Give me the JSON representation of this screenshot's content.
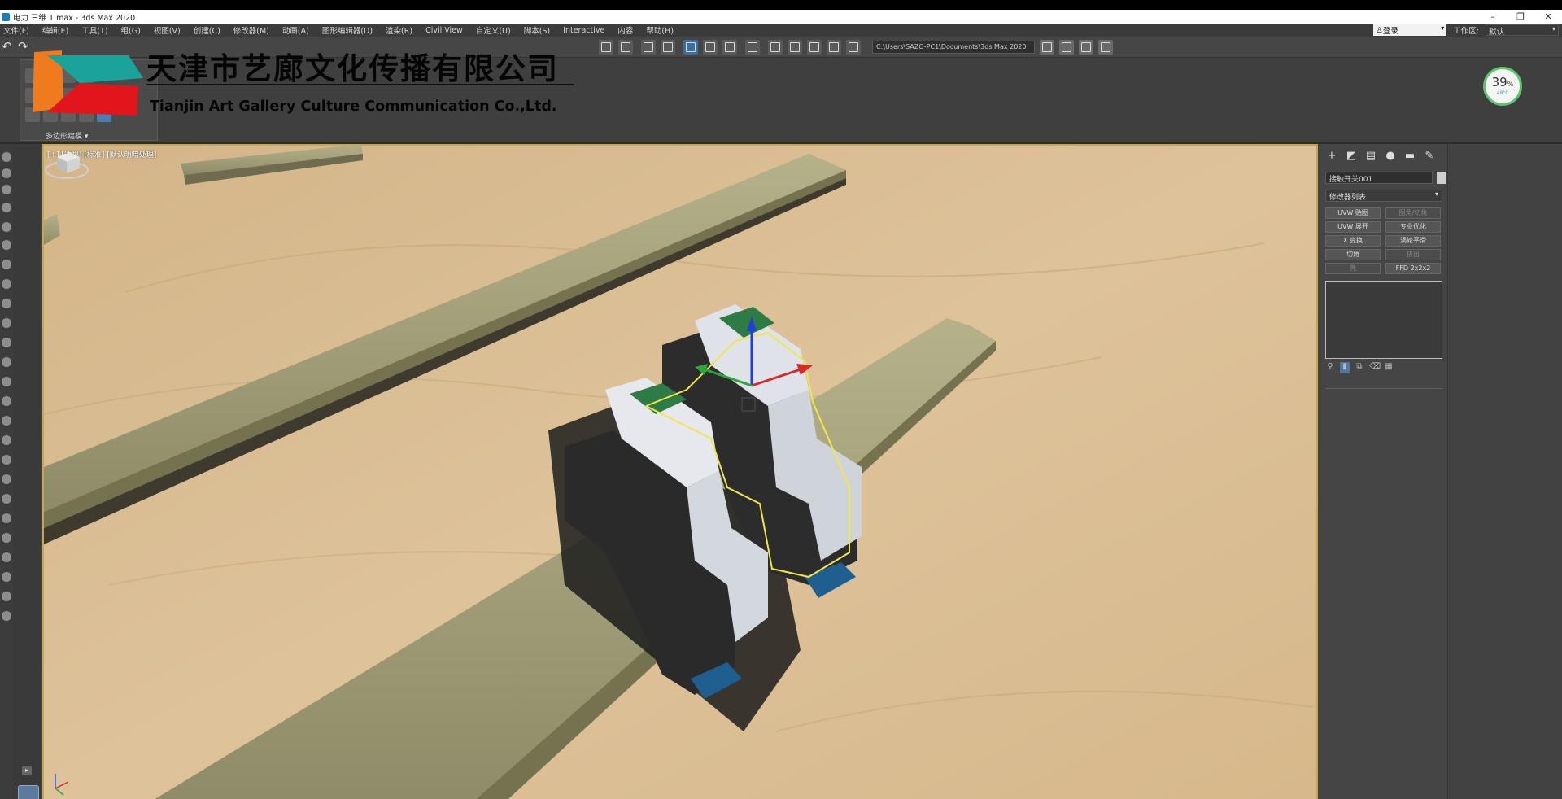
{
  "titlebar": {
    "title": "电力 三维 1.max - 3ds Max 2020",
    "minimize": "–",
    "restore": "❐",
    "close": "✕"
  },
  "menu": [
    "文件(F)",
    "编辑(E)",
    "工具(T)",
    "组(G)",
    "视图(V)",
    "创建(C)",
    "修改器(M)",
    "动画(A)",
    "图形编辑器(D)",
    "渲染(R)",
    "Civil View",
    "自定义(U)",
    "脚本(S)",
    "Interactive",
    "内容",
    "帮助(H)"
  ],
  "account": {
    "login_label": "登录",
    "workspace_label": "工作区:",
    "workspace_value": "默认"
  },
  "toolbar": {
    "project_path": "C:\\Users\\SAZO-PC1\\Documents\\3ds Max 2020"
  },
  "ribbon": {
    "panel_caption": "多边形建模 ▾"
  },
  "watermark": {
    "company_cn": "天津市艺廊文化传播有限公司",
    "company_en": "Tianjin Art Gallery Culture Communication Co.,Ltd.",
    "colors": {
      "orange": "#f07a1e",
      "teal": "#1aa39a",
      "red": "#e3151c"
    }
  },
  "performance": {
    "percent": "39",
    "percent_unit": "%",
    "temperature": "48°C",
    "ring_color": "#5cc46a"
  },
  "viewport": {
    "label": "[+] [透视] [标准] [默认明暗处理]",
    "frame_color": "#c8a64b"
  },
  "command_panel": {
    "object_name": "接触开关001",
    "modifier_list": "修改器列表",
    "modifier_buttons": [
      {
        "label": "UVW 贴图",
        "enabled": true
      },
      {
        "label": "图角/切角",
        "enabled": false
      },
      {
        "label": "UVW 展开",
        "enabled": true
      },
      {
        "label": "专业优化",
        "enabled": true
      },
      {
        "label": "X 变换",
        "enabled": true
      },
      {
        "label": "涡轮平滑",
        "enabled": true
      },
      {
        "label": "切角",
        "enabled": true
      },
      {
        "label": "挤出",
        "enabled": false
      },
      {
        "label": "壳",
        "enabled": false
      },
      {
        "label": "FFD 2x2x2",
        "enabled": true
      }
    ]
  }
}
